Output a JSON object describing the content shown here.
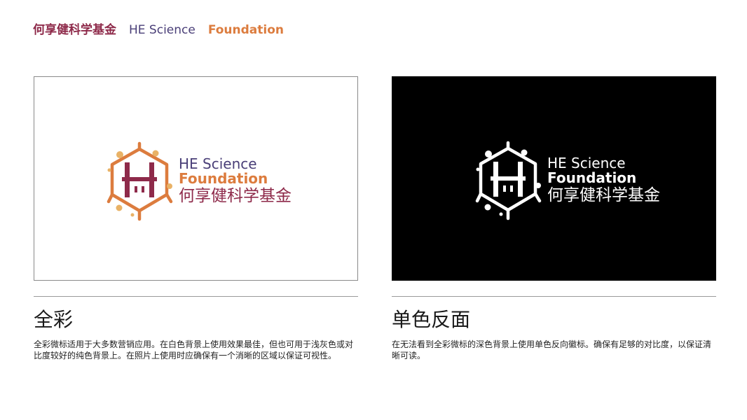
{
  "header": {
    "name_cn": "何享健科学基金",
    "name_en_1": "HE Science",
    "name_en_2": "Foundation"
  },
  "logo_text": {
    "line1": "HE Science",
    "line2": "Foundation",
    "line3": "何享健科学基金"
  },
  "colors": {
    "maroon": "#8e2a4a",
    "purple": "#4a3f78",
    "orange": "#dc7c3e",
    "gold": "#e9b266"
  },
  "sections": {
    "full_color": {
      "title": "全彩",
      "description": "全彩微标适用于大多数营销应用。在白色背景上使用效果最佳，但也可用于浅灰色或对比度较好的纯色背景上。在照片上使用时应确保有一个消晰的区域以保证可视性。"
    },
    "mono_reverse": {
      "title": "单色反面",
      "description": "在无法看到全彩微标的深色背景上使用单色反向徽标。确保有足够的对比度，以保证清晰可读。"
    }
  }
}
